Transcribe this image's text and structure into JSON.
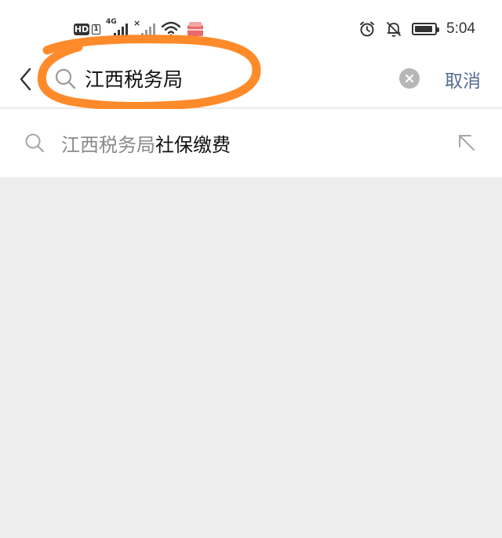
{
  "status_bar": {
    "hd_badge": "HD",
    "sim_number": "1",
    "network_type": "4G",
    "time": "5:04",
    "icons": [
      "signal-icon",
      "signal-no-service-icon",
      "wifi-icon",
      "notification-app-icon",
      "alarm-icon",
      "silent-bell-icon",
      "battery-icon"
    ]
  },
  "search": {
    "query": "江西税务局",
    "cancel_label": "取消",
    "icons": [
      "back-chevron-icon",
      "search-icon",
      "clear-icon"
    ],
    "highlight_color": "#ff8a2a"
  },
  "suggestions": [
    {
      "match": "江西税务局",
      "rest": "社保缴费",
      "icon": "search-icon",
      "action_icon": "fill-in-arrow-icon"
    }
  ],
  "colors": {
    "link": "#576b95",
    "background": "#ededed",
    "surface": "#ffffff",
    "muted_text": "#8a8a8a"
  }
}
